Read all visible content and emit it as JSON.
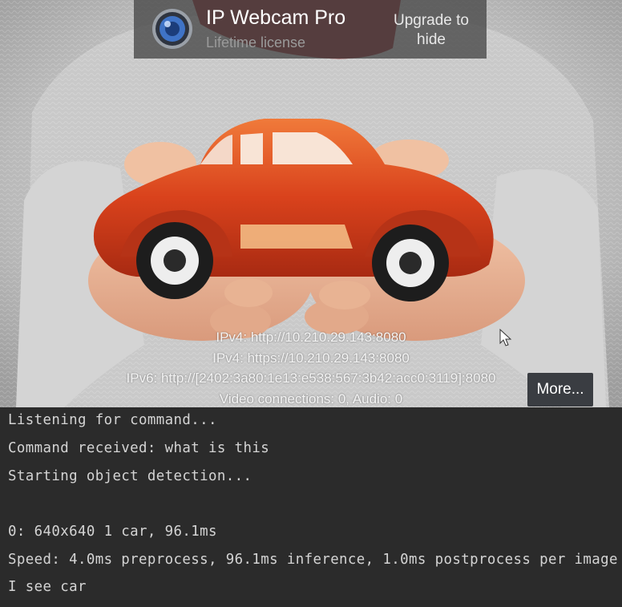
{
  "banner": {
    "app_title": "IP Webcam Pro",
    "subtitle": "Lifetime license",
    "upgrade_label": "Upgrade to hide"
  },
  "overlay": {
    "ipv4_http": "IPv4: http://10.210.29.143:8080",
    "ipv4_https": "IPv4: https://10.210.29.143:8080",
    "ipv6_http": "IPv6: http://[2402:3a80:1e13:e538:567:3b42:acc0:3119]:8080",
    "connections": "Video connections: 0, Audio: 0",
    "more_label": "More..."
  },
  "console": {
    "lines": [
      "Listening for command...",
      "Command received: what is this",
      "Starting object detection...",
      "",
      "0: 640x640 1 car, 96.1ms",
      "Speed: 4.0ms preprocess, 96.1ms inference, 1.0ms postprocess per image",
      "I see car"
    ]
  },
  "colors": {
    "console_bg": "#2b2b2b",
    "console_text": "#d4d4d4",
    "banner_bg": "rgba(70,70,70,0.78)",
    "car_red": "#d9421c"
  },
  "icons": {
    "app_icon": "camera-lens-icon",
    "cursor": "mouse-pointer-icon"
  }
}
